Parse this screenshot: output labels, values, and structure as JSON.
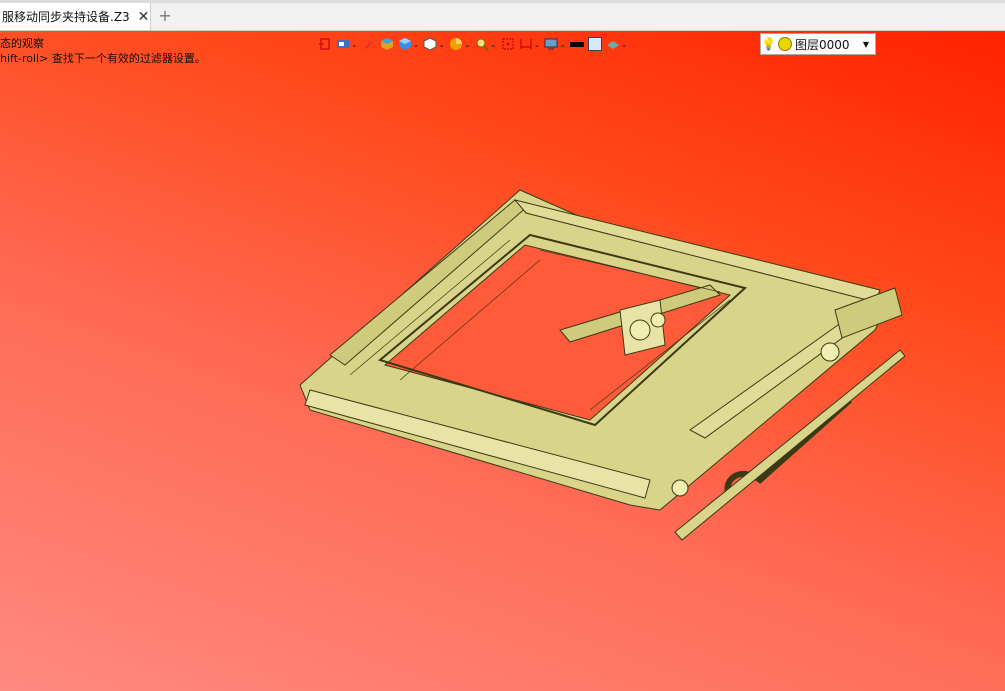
{
  "tab": {
    "title": "服移动同步夹持设备.Z3",
    "close_icon": "close-icon",
    "new_tab_icon": "plus-icon"
  },
  "status": {
    "line1": "态的观察",
    "line2": "hift-roll> 查找下一个有效的过滤器设置。"
  },
  "toolbar": {
    "items": [
      {
        "icon": "snap-icon",
        "dropdown": false
      },
      {
        "icon": "view-icon",
        "dropdown": true
      },
      {
        "icon": "pencil-icon",
        "dropdown": false
      },
      {
        "icon": "shaded-cube-icon",
        "dropdown": false
      },
      {
        "icon": "cube-icon",
        "dropdown": true
      },
      {
        "icon": "wire-cube-icon",
        "dropdown": true
      },
      {
        "icon": "pie-icon",
        "dropdown": true
      },
      {
        "icon": "zoom-icon",
        "dropdown": true
      },
      {
        "icon": "frame-icon",
        "dropdown": false
      },
      {
        "icon": "dimension-icon",
        "dropdown": true
      },
      {
        "icon": "display-icon",
        "dropdown": true
      },
      {
        "icon": "color-black-icon",
        "dropdown": false
      },
      {
        "icon": "color-white-icon",
        "dropdown": false
      },
      {
        "icon": "plane-icon",
        "dropdown": true
      }
    ],
    "layer": {
      "value": "图层0000",
      "bulb_icon": "lightbulb-icon",
      "state_icon": "sun-icon"
    }
  },
  "colors": {
    "bg_top": "#ff2200",
    "bg_bottom": "#ff8a80",
    "model_fill": "#d8d48a",
    "model_edge": "#3b3a14"
  }
}
